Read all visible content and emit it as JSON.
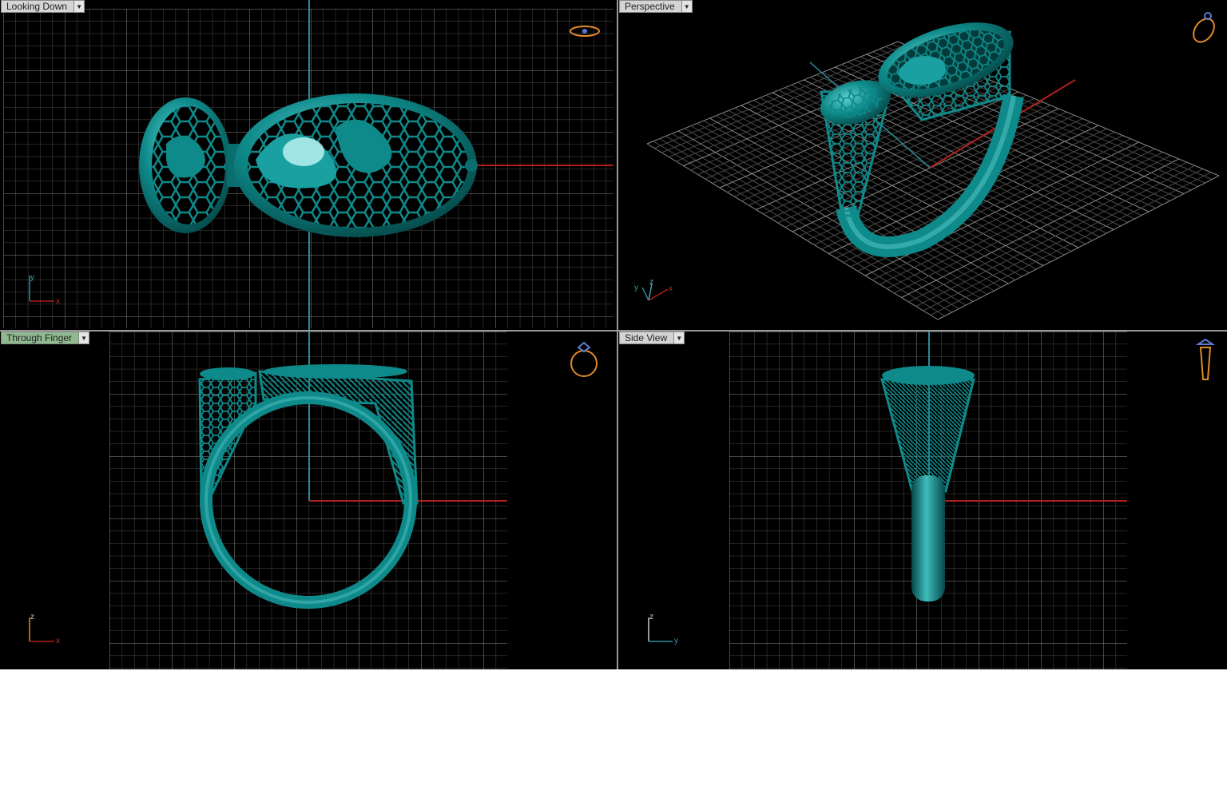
{
  "viewports": [
    {
      "id": "top",
      "label": "Looking Down",
      "axes": [
        "y",
        "x"
      ]
    },
    {
      "id": "persp",
      "label": "Perspective",
      "axes": [
        "y",
        "z",
        "x"
      ]
    },
    {
      "id": "front",
      "label": "Through Finger",
      "axes": [
        "z",
        "x"
      ],
      "active": true
    },
    {
      "id": "side",
      "label": "Side View",
      "axes": [
        "z",
        "y"
      ]
    }
  ],
  "icons": {
    "view_cube": "ring-orientation-icon",
    "dropdown": "chevron-down-icon"
  },
  "colors": {
    "model": "#0e8a8a",
    "grid": "#5a5a5a",
    "x_axis": "#b0201a",
    "y_axis": "#2a8a9a",
    "widget": "#e08a2a",
    "active_label": "#8fb98f"
  }
}
